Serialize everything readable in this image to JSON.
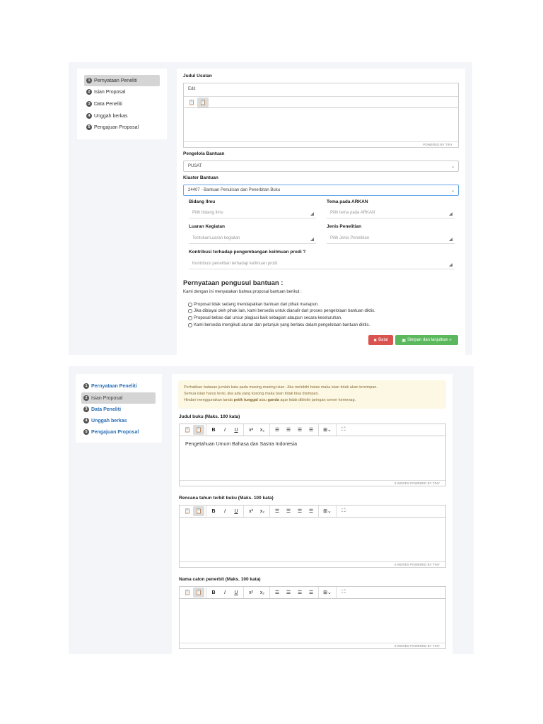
{
  "steps": [
    "Pernyataan Peneliti",
    "Isian Proposal",
    "Data Peneliti",
    "Unggah berkas",
    "Pengajuan Proposal"
  ],
  "step_numbers": [
    "1",
    "2",
    "3",
    "4",
    "5"
  ],
  "page1": {
    "judul_usulan_label": "Judul Usulan",
    "menu_edit": "Edit",
    "powered": "POWERED BY TINY",
    "pengelola_label": "Pengelola Bantuan",
    "pengelola_value": "PUSAT",
    "klaster_label": "Klaster Bantuan",
    "klaster_value": "24407 - Bantuan Penulisan dan Penerbitan Buku",
    "bidang_label": "Bidang Ilmu",
    "bidang_ph": "Pilih bidang ilmu",
    "tema_label": "Tema pada ARKAN",
    "tema_ph": "Pilih tema pada ARKAN",
    "luaran_label": "Luaran Kegiatan",
    "luaran_ph": "TentukanLuaran kegiatan",
    "jenis_label": "Jenis Penelitian",
    "jenis_ph": "Pilih Jenis Penelitian",
    "kontribusi_label": "Kontribusi terhadap pengembangan keilmuan prodi ?",
    "kontribusi_ph": "Kontribusi penelitian terhadap keilmuan prodi",
    "statement_title": "Pernyataan pengusul bantuan :",
    "statement_intro": "Kami dengan ini menyatakan bahwa proposal bantuan berikut :",
    "checks": [
      "Proposal tidak sedang mendapatkan bantuan dari pihak manapun.",
      "Jika dibiayai oleh pihak lain, kami bersedia untuk dianulir dari proses pengelolaan bantuan diktis.",
      "Proposal bebas dari unsur plagiasi baik sebagian ataupun secara keseluruhan.",
      "Kami bersedia mengikuti aturan dan petunjuk yang berlaku dalam pengelolaan bantuan diktis."
    ],
    "batal": "Batal",
    "simpan": "Simpan dan lanjutkan »"
  },
  "page2": {
    "alert_line1": "Perhatikan batasan jumlah kata pada masing-masing isian. Jika melebihi batas maka isian tidak akan tersimpan.",
    "alert_line2": "Semua isian harus terisi, jika ada yang kosong maka isian tidak bisa disimpan.",
    "alert_line3a": "Hindari menggunakan tanda ",
    "alert_bold1": "petik tunggal",
    "alert_line3b": " atau ",
    "alert_bold2": "ganda",
    "alert_line3c": " agar tidak diblokir jaringan server kemenag.",
    "editors": [
      {
        "label": "Judul buku (Maks. 100 kata)",
        "content": "Pengetahuan Umum Bahasa dan Sastra Indonesia",
        "status": "6 WORDS  POWERED BY TINY"
      },
      {
        "label": "Rencana tahun terbit buku (Maks. 100 kata)",
        "content": "",
        "status": "0 WORDS  POWERED BY TINY"
      },
      {
        "label": "Nama calon penerbit (Maks. 100 kata)",
        "content": "",
        "status": "0 WORDS  POWERED BY TINY"
      }
    ]
  },
  "colors": {
    "danger": "#d9534f",
    "success": "#5cb85c",
    "alert_bg": "#fcf8e3",
    "link": "#2a6fb5"
  }
}
